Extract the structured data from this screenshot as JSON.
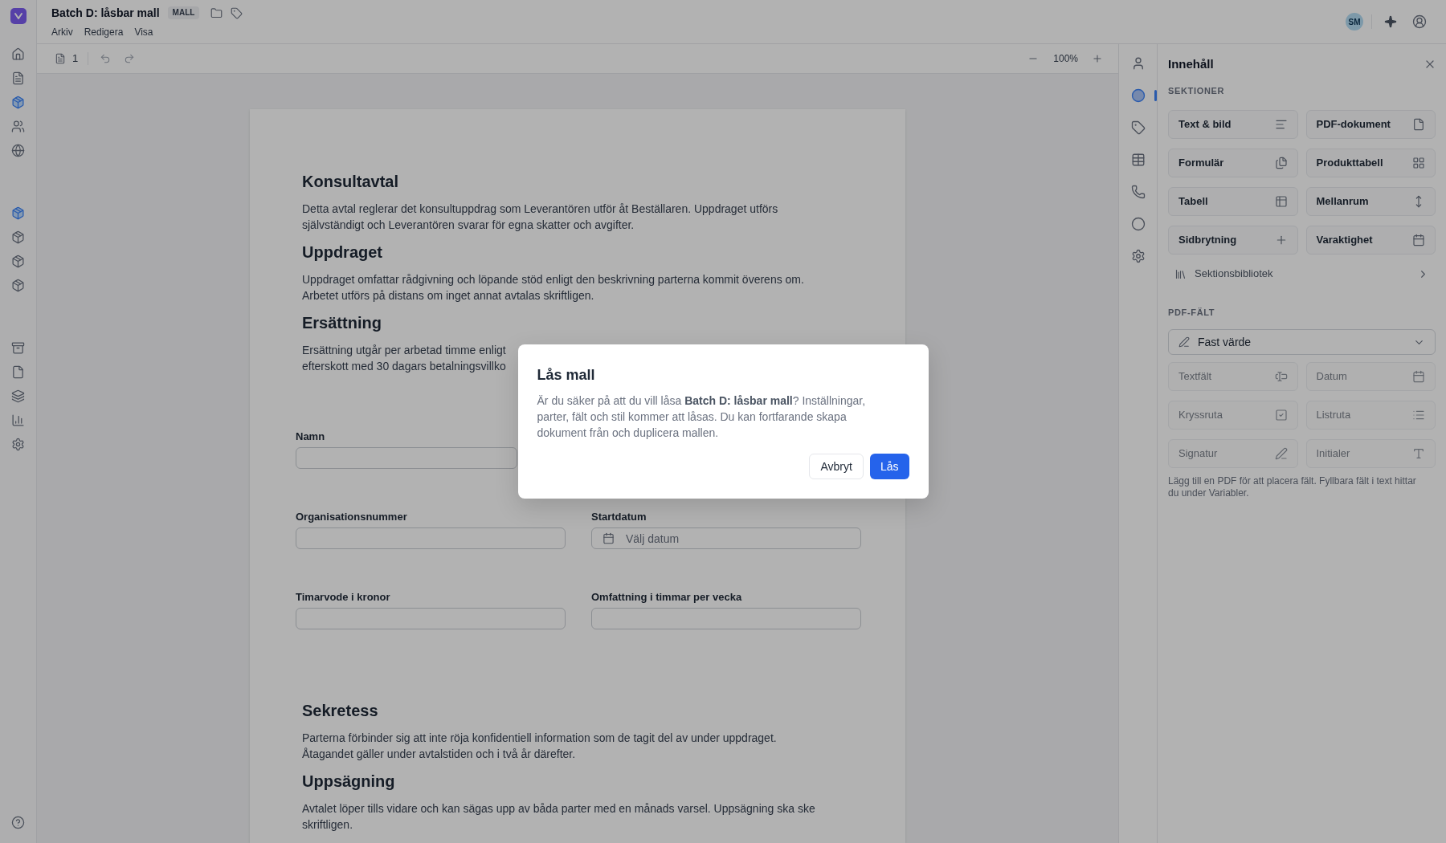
{
  "header": {
    "title": "Batch D: låsbar mall",
    "badge": "MALL",
    "menu": [
      "Arkiv",
      "Redigera",
      "Visa"
    ],
    "avatar": "SM"
  },
  "sidebar": {
    "groups": [
      {
        "items": [
          {
            "selected": false
          },
          {
            "selected": false
          },
          {
            "selected": true
          },
          {
            "selected": false
          },
          {
            "selected": false
          }
        ]
      },
      {
        "items": [
          {
            "selected": true
          },
          {
            "selected": false
          },
          {
            "selected": false
          },
          {
            "selected": false
          }
        ]
      },
      {
        "items": [
          {
            "selected": false
          },
          {
            "selected": false
          },
          {
            "selected": false
          },
          {
            "selected": false
          },
          {
            "selected": false
          }
        ]
      }
    ]
  },
  "toolbar": {
    "page_count": "1",
    "zoom": "100%"
  },
  "document": {
    "top_sections": [
      {
        "heading": "Konsultavtal",
        "lines": [
          "Detta avtal reglerar det konsultuppdrag som Leverantören utför åt Beställaren. Uppdraget utförs",
          "självständigt och Leverantören svarar för egna skatter och avgifter."
        ]
      },
      {
        "heading": "Uppdraget",
        "lines": [
          "Uppdraget omfattar rådgivning och löpande stöd enligt den beskrivning parterna kommit överens om.",
          "Arbetet utförs på distans om inget annat avtalas skriftligen."
        ]
      },
      {
        "heading": "Ersättning",
        "lines": [
          "Ersättning utgår per arbetad timme enligt",
          "efterskott med 30 dagars betalningsvillko"
        ]
      }
    ],
    "form_rows": [
      {
        "fields": [
          {
            "label": "Namn",
            "kind": "text"
          }
        ]
      },
      {
        "fields": [
          {
            "label": "Organisationsnummer",
            "kind": "text"
          },
          {
            "label": "Startdatum",
            "kind": "date",
            "placeholder": "Välj datum"
          }
        ]
      },
      {
        "fields": [
          {
            "label": "Timarvode i kronor",
            "kind": "text"
          },
          {
            "label": "Omfattning i timmar per vecka",
            "kind": "text"
          }
        ]
      }
    ],
    "bottom_sections": [
      {
        "heading": "Sekretess",
        "lines": [
          "Parterna förbinder sig att inte röja konfidentiell information som de tagit del av under uppdraget.",
          "Åtagandet gäller under avtalstiden och i två år därefter."
        ]
      },
      {
        "heading": "Uppsägning",
        "lines": [
          "Avtalet löper tills vidare och kan sägas upp av båda parter med en månads varsel. Uppsägning ska ske",
          "skriftligen."
        ]
      }
    ]
  },
  "side_rail": {
    "items": [
      {
        "selected": false
      },
      {
        "selected": true
      },
      {
        "selected": false
      },
      {
        "selected": false
      },
      {
        "selected": false
      },
      {
        "selected": false
      },
      {
        "selected": false
      }
    ]
  },
  "panel": {
    "title": "Innehåll",
    "sections_label": "SEKTIONER",
    "sections": [
      "Text & bild",
      "PDF-dokument",
      "Formulär",
      "Produkttabell",
      "Tabell",
      "Mellanrum",
      "Sidbrytning",
      "Varaktighet"
    ],
    "library": "Sektionsbibliotek",
    "pdf_label": "PDF-FÄLT",
    "field_mode": "Fast värde",
    "pdf_fields": [
      {
        "label": "Textfält",
        "disabled": true
      },
      {
        "label": "Datum",
        "disabled": true
      },
      {
        "label": "Kryssruta",
        "disabled": true
      },
      {
        "label": "Listruta",
        "disabled": true
      },
      {
        "label": "Signatur",
        "disabled": true
      },
      {
        "label": "Initialer",
        "disabled": true
      }
    ],
    "hint": "Lägg till en PDF för att placera fält. Fyllbara fält i text hittar du under Variabler."
  },
  "dialog": {
    "title": "Lås mall",
    "message": "Är du säker på att du vill låsa **Batch D: låsbar mall**? Inställningar, parter, fält och stil kommer att låsas. Du kan fortfarande skapa dokument från och duplicera mallen.",
    "buttons": [
      {
        "label": "Avbryt",
        "kind": "secondary"
      },
      {
        "label": "Lås",
        "kind": "primary"
      }
    ]
  }
}
